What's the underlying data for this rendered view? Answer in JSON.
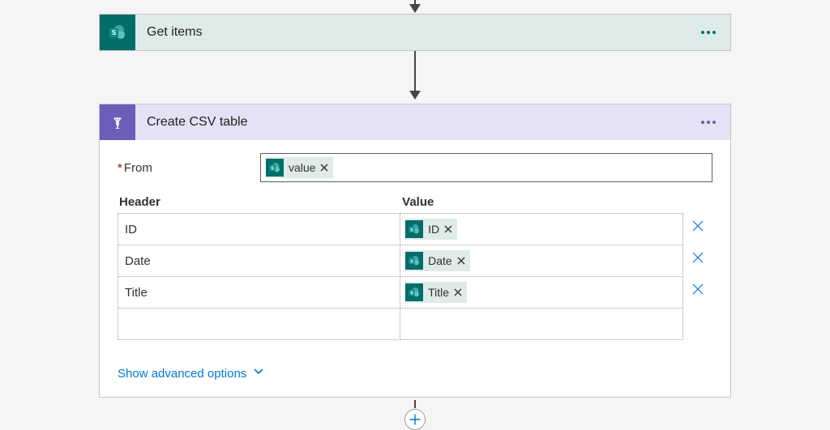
{
  "step1": {
    "title": "Get items",
    "icon": "sharepoint-icon"
  },
  "step2": {
    "title": "Create CSV table",
    "icon": "data-operations-icon",
    "from_label": "From",
    "from_token": "value",
    "header_col_label": "Header",
    "value_col_label": "Value",
    "rows": [
      {
        "header": "ID",
        "value_token": "ID"
      },
      {
        "header": "Date",
        "value_token": "Date"
      },
      {
        "header": "Title",
        "value_token": "Title"
      }
    ],
    "advanced_label": "Show advanced options"
  }
}
